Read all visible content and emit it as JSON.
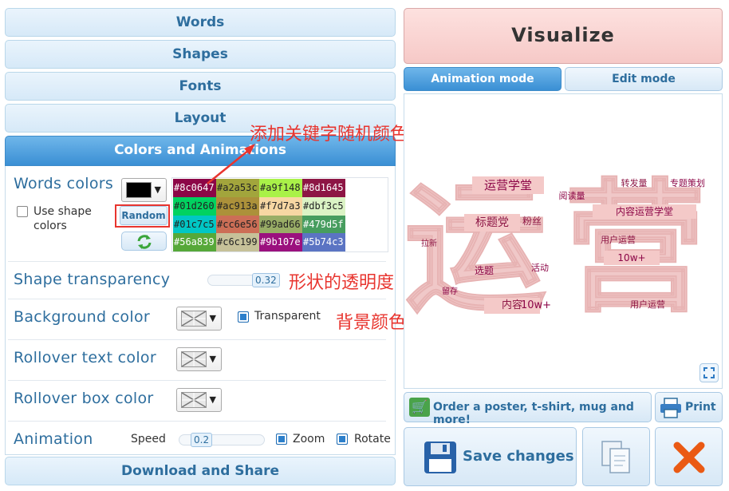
{
  "accordion": {
    "words": "Words",
    "shapes": "Shapes",
    "fonts": "Fonts",
    "layout": "Layout",
    "colors": "Colors and Animations",
    "download": "Download and Share"
  },
  "colors_panel": {
    "words_colors_label": "Words colors",
    "use_shape_colors": "Use shape colors",
    "random_button": "Random",
    "palette": [
      "#8c0647",
      "#a2a53c",
      "#a9f148",
      "#8d1645",
      "#01d260",
      "#ac913a",
      "#f7d7a3",
      "#dbf3c5",
      "#01c7c5",
      "#cc6e56",
      "#99ad66",
      "#479d5f",
      "#56a839",
      "#c6c199",
      "#9b107e",
      "#5b74c3"
    ],
    "shape_transparency_label": "Shape transparency",
    "shape_transparency_value": "0.32",
    "background_color_label": "Background color",
    "transparent_label": "Transparent",
    "rollover_text_label": "Rollover text color",
    "rollover_box_label": "Rollover box color",
    "animation_label": "Animation",
    "speed_label": "Speed",
    "speed_value": "0.2",
    "zoom_label": "Zoom",
    "rotate_label": "Rotate"
  },
  "annotations": {
    "a1": "添加关键字随机颜色",
    "a2": "形状的透明度",
    "a3": "背景颜色"
  },
  "right": {
    "visualize": "Visualize",
    "animation_tab": "Animation mode",
    "edit_tab": "Edit mode",
    "order_button": "Order a poster, t-shirt, mug and more!",
    "print_button": "Print",
    "save_button": "Save changes"
  },
  "cloud": {
    "big_chars": [
      "运",
      "营"
    ],
    "words": [
      "运营学堂",
      "标题党",
      "内容",
      "10w+",
      "留存",
      "拉新",
      "转发量",
      "用户运营",
      "活动",
      "选题",
      "内容运营学堂",
      "粉丝",
      "阅读量",
      "专题策划"
    ]
  }
}
